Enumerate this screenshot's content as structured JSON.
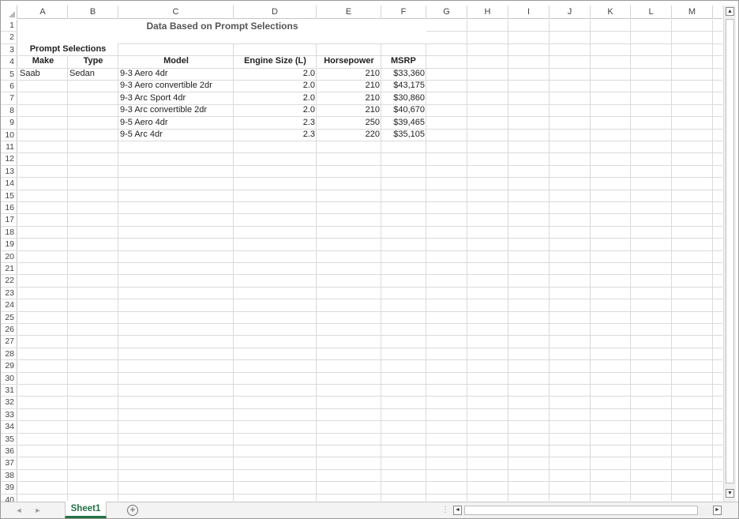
{
  "sheet": {
    "columns": [
      "A",
      "B",
      "C",
      "D",
      "E",
      "F",
      "G",
      "H",
      "I",
      "J",
      "K",
      "L",
      "M"
    ],
    "rows": [
      "1",
      "2",
      "3",
      "4",
      "5",
      "6",
      "7",
      "8",
      "9",
      "10",
      "11",
      "12",
      "13",
      "14",
      "15",
      "16",
      "17",
      "18",
      "19",
      "20",
      "21",
      "22",
      "23",
      "24",
      "25",
      "26",
      "27",
      "28",
      "29",
      "30",
      "31",
      "32",
      "33",
      "34",
      "35",
      "36",
      "37",
      "38",
      "39",
      "40"
    ],
    "title": "Data Based on Prompt Selections",
    "prompt_label": "Prompt Selections",
    "headers": {
      "make": "Make",
      "type": "Type",
      "model": "Model",
      "engine": "Engine Size (L)",
      "horsepower": "Horsepower",
      "msrp": "MSRP"
    },
    "make_value": "Saab",
    "type_value": "Sedan",
    "data_rows": [
      {
        "model": "9-3 Aero 4dr",
        "engine": "2.0",
        "horsepower": "210",
        "msrp": "$33,360"
      },
      {
        "model": "9-3 Aero convertible 2dr",
        "engine": "2.0",
        "horsepower": "210",
        "msrp": "$43,175"
      },
      {
        "model": "9-3 Arc Sport 4dr",
        "engine": "2.0",
        "horsepower": "210",
        "msrp": "$30,860"
      },
      {
        "model": "9-3 Arc convertible 2dr",
        "engine": "2.0",
        "horsepower": "210",
        "msrp": "$40,670"
      },
      {
        "model": "9-5 Aero 4dr",
        "engine": "2.3",
        "horsepower": "250",
        "msrp": "$39,465"
      },
      {
        "model": "9-5 Arc 4dr",
        "engine": "2.3",
        "horsepower": "220",
        "msrp": "$35,105"
      }
    ]
  },
  "tabs": {
    "active": "Sheet1",
    "add_label": "+",
    "prev_label": "◄",
    "next_label": "►",
    "dots_label": "⋮"
  },
  "scroll": {
    "up": "▲",
    "down": "▼",
    "left": "◄",
    "right": "►"
  }
}
